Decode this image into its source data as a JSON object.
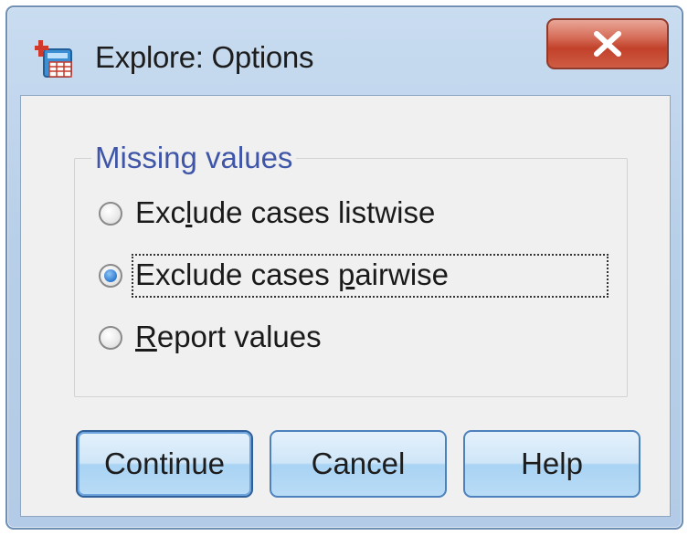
{
  "window": {
    "title": "Explore: Options",
    "close_glyph": "X"
  },
  "icons": {
    "app": "spss-dialog-icon",
    "close": "close-icon"
  },
  "missing_values": {
    "group_label": "Missing values",
    "options": [
      {
        "before": "Exc",
        "mnemonic": "l",
        "after": "ude cases listwise",
        "selected": false
      },
      {
        "before": "Exclude cases ",
        "mnemonic": "p",
        "after": "airwise",
        "selected": true
      },
      {
        "before": "",
        "mnemonic": "R",
        "after": "eport values",
        "selected": false
      }
    ]
  },
  "buttons": {
    "continue": "Continue",
    "cancel": "Cancel",
    "help": "Help"
  },
  "colors": {
    "group_label": "#3f56a8",
    "close_button": "#c2412a",
    "radio_selected": "#2e7bd0"
  }
}
